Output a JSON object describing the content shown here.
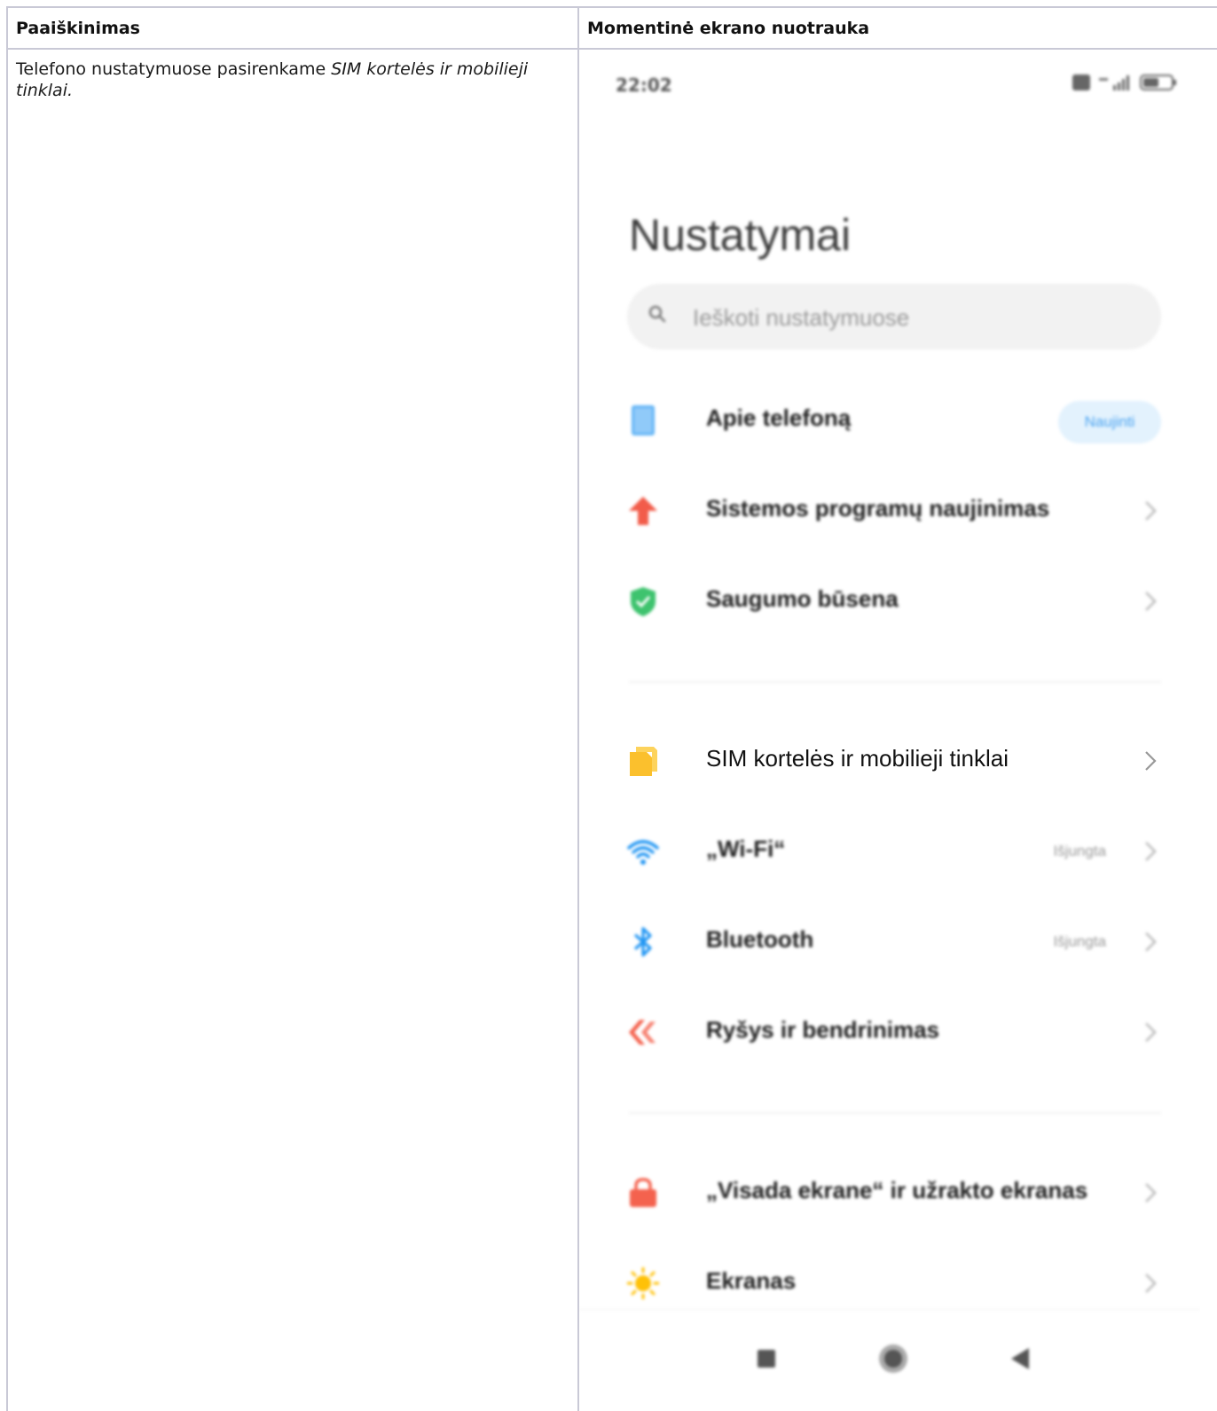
{
  "table": {
    "header_explanation": "Paaiškinimas",
    "header_screenshot": "Momentinė ekrano nuotrauka",
    "explanation_prefix": "Telefono nustatymuose pasirenkame ",
    "explanation_emphasis": "SIM kortelės ir mobilieji tinklai."
  },
  "phone": {
    "status_time": "22:02",
    "battery_level": 0.56,
    "title": "Nustatymai",
    "search_placeholder": "Ieškoti nustatymuose",
    "items": [
      {
        "label": "Apie telefoną",
        "badge": "Naujinti",
        "icon": "phone-icon",
        "color": "#64b5f6"
      },
      {
        "label": "Sistemos programų naujinimas",
        "icon": "arrow-up-icon",
        "color": "#f25c4a"
      },
      {
        "label": "Saugumo būsena",
        "icon": "shield-check-icon",
        "color": "#3ec36e"
      },
      {
        "label": "SIM kortelės ir mobilieji tinklai",
        "icon": "sim-card-icon",
        "color": "#fbc02d"
      },
      {
        "label": "„Wi-Fi“",
        "status": "Išjungta",
        "icon": "wifi-icon",
        "color": "#2196f3"
      },
      {
        "label": "Bluetooth",
        "status": "Išjungta",
        "icon": "bluetooth-icon",
        "color": "#2196f3"
      },
      {
        "label": "Ryšys ir bendrinimas",
        "icon": "share-connection-icon",
        "color": "#f4624e"
      },
      {
        "label": "„Visada ekrane“ ir užrakto ekranas",
        "icon": "lock-icon",
        "color": "#f4624e"
      },
      {
        "label": "Ekranas",
        "icon": "sun-icon",
        "color": "#ffc107"
      }
    ]
  }
}
